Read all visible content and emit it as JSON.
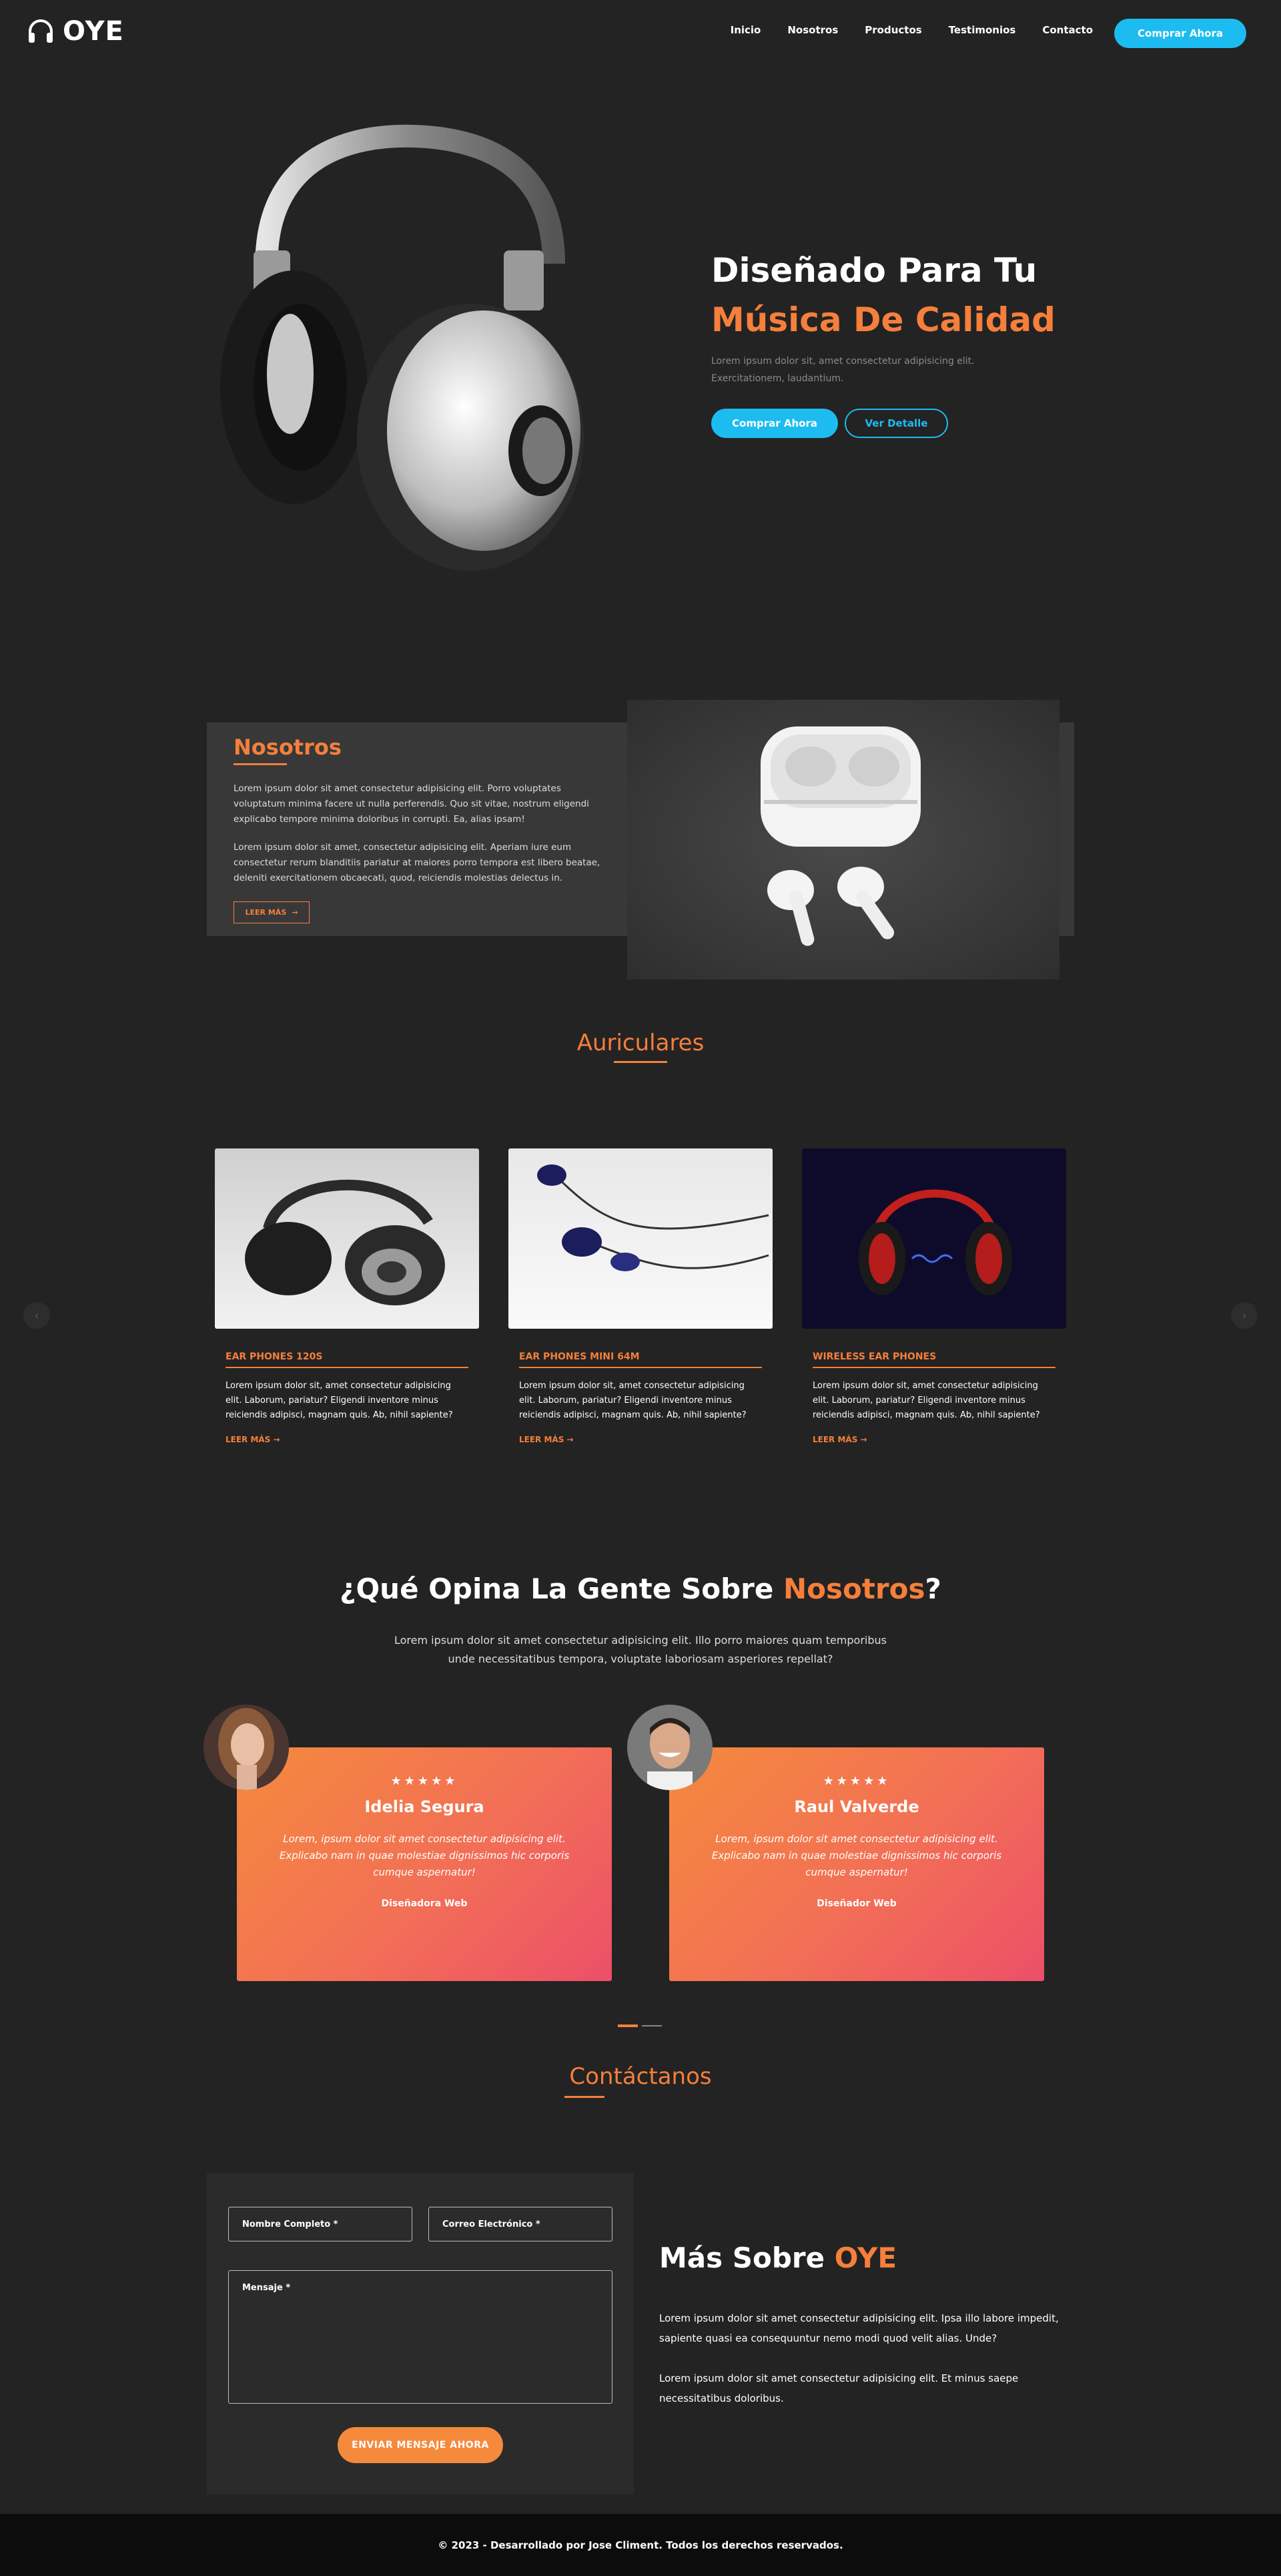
{
  "nav": {
    "logo_text": "OYE",
    "menu": [
      "Inicio",
      "Nosotros",
      "Productos",
      "Testimonios",
      "Contacto"
    ],
    "cta": "Comprar Ahora"
  },
  "hero": {
    "title_line1": "Diseñado Para Tu",
    "title_line2": "Música De Calidad",
    "description": "Lorem ipsum dolor sit, amet consectetur adipisicing elit. Exercitationem, laudantium.",
    "primary_button": "Comprar Ahora",
    "secondary_button": "Ver Detalle"
  },
  "about": {
    "title": "Nosotros",
    "paragraph1": "Lorem ipsum dolor sit amet consectetur adipisicing elit. Porro voluptates voluptatum minima facere ut nulla perferendis. Quo sit vitae, nostrum eligendi explicabo tempore minima doloribus in corrupti. Ea, alias ipsam!",
    "paragraph2": "Lorem ipsum dolor sit amet, consectetur adipisicing elit. Aperiam iure eum consectetur rerum blanditiis pariatur at maiores porro tempora est libero beatae, deleniti exercitationem obcaecati, quod, reiciendis molestias delectus in.",
    "button": "LEER MÁS",
    "button_icon": "arrow-right-icon"
  },
  "products": {
    "title": "Auriculares",
    "items": [
      {
        "title": "EAR PHONES 120S",
        "text": "Lorem ipsum dolor sit, amet consectetur adipisicing elit. Laborum, pariatur? Eligendi inventore minus reiciendis adipisci, magnam quis. Ab, nihil sapiente?",
        "link": "LEER MÁS"
      },
      {
        "title": "EAR PHONES MINI 64M",
        "text": "Lorem ipsum dolor sit, amet consectetur adipisicing elit. Laborum, pariatur? Eligendi inventore minus reiciendis adipisci, magnam quis. Ab, nihil sapiente?",
        "link": "LEER MÁS"
      },
      {
        "title": "WIRELESS EAR PHONES",
        "text": "Lorem ipsum dolor sit, amet consectetur adipisicing elit. Laborum, pariatur? Eligendi inventore minus reiciendis adipisci, magnam quis. Ab, nihil sapiente?",
        "link": "LEER MÁS"
      }
    ]
  },
  "testimonials": {
    "title_part1": "¿Qué Opina La Gente Sobre ",
    "title_part2": "Nosotros",
    "title_part3": "?",
    "subtitle": "Lorem ipsum dolor sit amet consectetur adipisicing elit. Illo porro maiores quam temporibus unde necessitatibus tempora, voluptate laboriosam asperiores repellat?",
    "items": [
      {
        "stars": "★★★★★",
        "name": "Idelia Segura",
        "quote": "Lorem, ipsum dolor sit amet consectetur adipisicing elit. Explicabo nam in quae molestiae dignissimos hic corporis cumque aspernatur!",
        "role": "Diseñadora Web"
      },
      {
        "stars": "★★★★★",
        "name": "Raul Valverde",
        "quote": "Lorem, ipsum dolor sit amet consectetur adipisicing elit. Explicabo nam in quae molestiae dignissimos hic corporis cumque aspernatur!",
        "role": "Diseñador Web"
      }
    ]
  },
  "contact": {
    "title": "Contáctanos",
    "name_placeholder": "Nombre Completo *",
    "email_placeholder": "Correo Electrónico *",
    "message_placeholder": "Mensaje *",
    "submit": "ENVIAR MENSAJE AHORA",
    "more_title_part1": "Más Sobre ",
    "more_title_part2": "OYE",
    "more_p1": "Lorem ipsum dolor sit amet consectetur adipisicing elit. Ipsa illo labore impedit, sapiente quasi ea consequuntur nemo modi quod velit alias. Unde?",
    "more_p2": "Lorem ipsum dolor sit amet consectetur adipisicing elit. Et minus saepe necessitatibus doloribus."
  },
  "footer": {
    "text": "© 2023 - Desarrollado por Jose Climent. Todos los derechos reservados."
  },
  "colors": {
    "background": "#232323",
    "accent_orange": "#f57f3b",
    "accent_cyan": "#1dbcf0",
    "card_gradient_start": "#f58a3c",
    "card_gradient_end": "#ec4f68",
    "footer_bg": "#0c0c0c"
  }
}
